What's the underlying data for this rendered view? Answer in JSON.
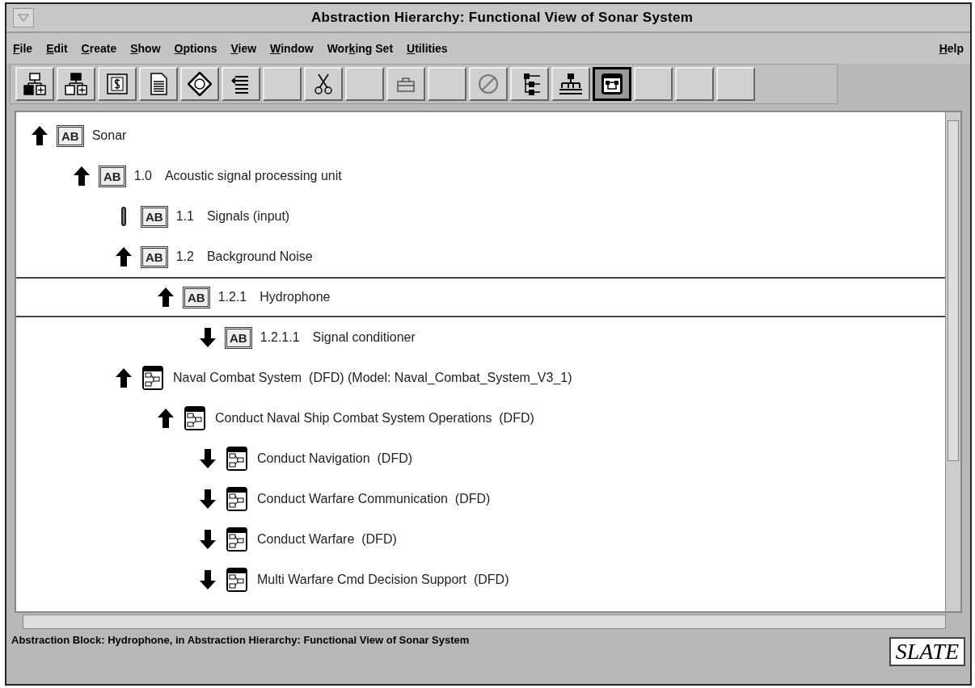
{
  "window": {
    "title": "Abstraction Hierarchy: Functional View of Sonar System"
  },
  "menu": [
    {
      "key": "F",
      "post": "ile"
    },
    {
      "key": "E",
      "post": "dit"
    },
    {
      "key": "C",
      "post": "reate"
    },
    {
      "key": "S",
      "post": "how"
    },
    {
      "key": "O",
      "post": "ptions"
    },
    {
      "key": "V",
      "post": "iew"
    },
    {
      "key": "W",
      "post": "indow"
    },
    {
      "pre": "Wor",
      "key": "k",
      "post": "ing Set"
    },
    {
      "key": "U",
      "post": "tilities"
    }
  ],
  "help_menu": {
    "key": "H",
    "post": "elp"
  },
  "toolbar": [
    {
      "kind": "tree-add",
      "selected": false
    },
    {
      "kind": "tree-add-alt",
      "selected": false
    },
    {
      "kind": "dollar",
      "selected": false
    },
    {
      "kind": "document",
      "selected": false
    },
    {
      "kind": "diamond",
      "selected": false
    },
    {
      "kind": "list",
      "selected": false
    },
    {
      "kind": "blank",
      "selected": false
    },
    {
      "kind": "scissors",
      "selected": false
    },
    {
      "kind": "blank",
      "selected": false
    },
    {
      "kind": "case",
      "selected": false
    },
    {
      "kind": "blank",
      "selected": false
    },
    {
      "kind": "prohibit",
      "selected": false
    },
    {
      "kind": "outline",
      "selected": false
    },
    {
      "kind": "hierarchy",
      "selected": false
    },
    {
      "kind": "frame",
      "selected": true
    },
    {
      "kind": "blank",
      "selected": false
    },
    {
      "kind": "blank",
      "selected": false
    },
    {
      "kind": "blank",
      "selected": false
    }
  ],
  "tree": [
    {
      "kind": "up",
      "icon": {
        "kind": "ab",
        "text": "AB"
      },
      "label": "Sonar",
      "selected": false,
      "children": [
        {
          "kind": "up",
          "icon": {
            "kind": "ab",
            "text": "AB"
          },
          "number": "1.0",
          "label": "Acoustic signal processing unit",
          "selected": false,
          "children": [
            {
              "kind": "bar",
              "icon": {
                "kind": "ab",
                "text": "AB"
              },
              "number": "1.1",
              "label": "Signals (input)",
              "selected": false
            },
            {
              "kind": "up",
              "icon": {
                "kind": "ab",
                "text": "AB"
              },
              "number": "1.2",
              "label": "Background Noise",
              "selected": false,
              "children": [
                {
                  "kind": "up",
                  "icon": {
                    "kind": "ab",
                    "text": "AB"
                  },
                  "number": "1.2.1",
                  "label": "Hydrophone",
                  "selected": true,
                  "children": [
                    {
                      "kind": "down",
                      "icon": {
                        "kind": "ab",
                        "text": "AB"
                      },
                      "number": "1.2.1.1",
                      "label": "Signal conditioner",
                      "selected": false
                    }
                  ]
                }
              ]
            },
            {
              "kind": "up",
              "icon": {
                "kind": "dfd"
              },
              "label": "Naval Combat System  (DFD) (Model: Naval_Combat_System_V3_1)",
              "selected": false,
              "children": [
                {
                  "kind": "up",
                  "icon": {
                    "kind": "dfd"
                  },
                  "label": "Conduct Naval Ship Combat System Operations  (DFD)",
                  "selected": false,
                  "children": [
                    {
                      "kind": "down",
                      "icon": {
                        "kind": "dfd"
                      },
                      "label": "Conduct Navigation  (DFD)",
                      "selected": false
                    },
                    {
                      "kind": "down",
                      "icon": {
                        "kind": "dfd"
                      },
                      "label": "Conduct Warfare Communication  (DFD)",
                      "selected": false
                    },
                    {
                      "kind": "down",
                      "icon": {
                        "kind": "dfd"
                      },
                      "label": "Conduct Warfare  (DFD)",
                      "selected": false
                    },
                    {
                      "kind": "down",
                      "icon": {
                        "kind": "dfd"
                      },
                      "label": "Multi Warfare Cmd Decision Support  (DFD)",
                      "selected": false
                    }
                  ]
                }
              ]
            }
          ]
        }
      ]
    }
  ],
  "status_bar": {
    "text": "Abstraction Block: Hydrophone, in Abstraction Hierarchy: Functional View of Sonar System",
    "logo": "SLATE"
  }
}
